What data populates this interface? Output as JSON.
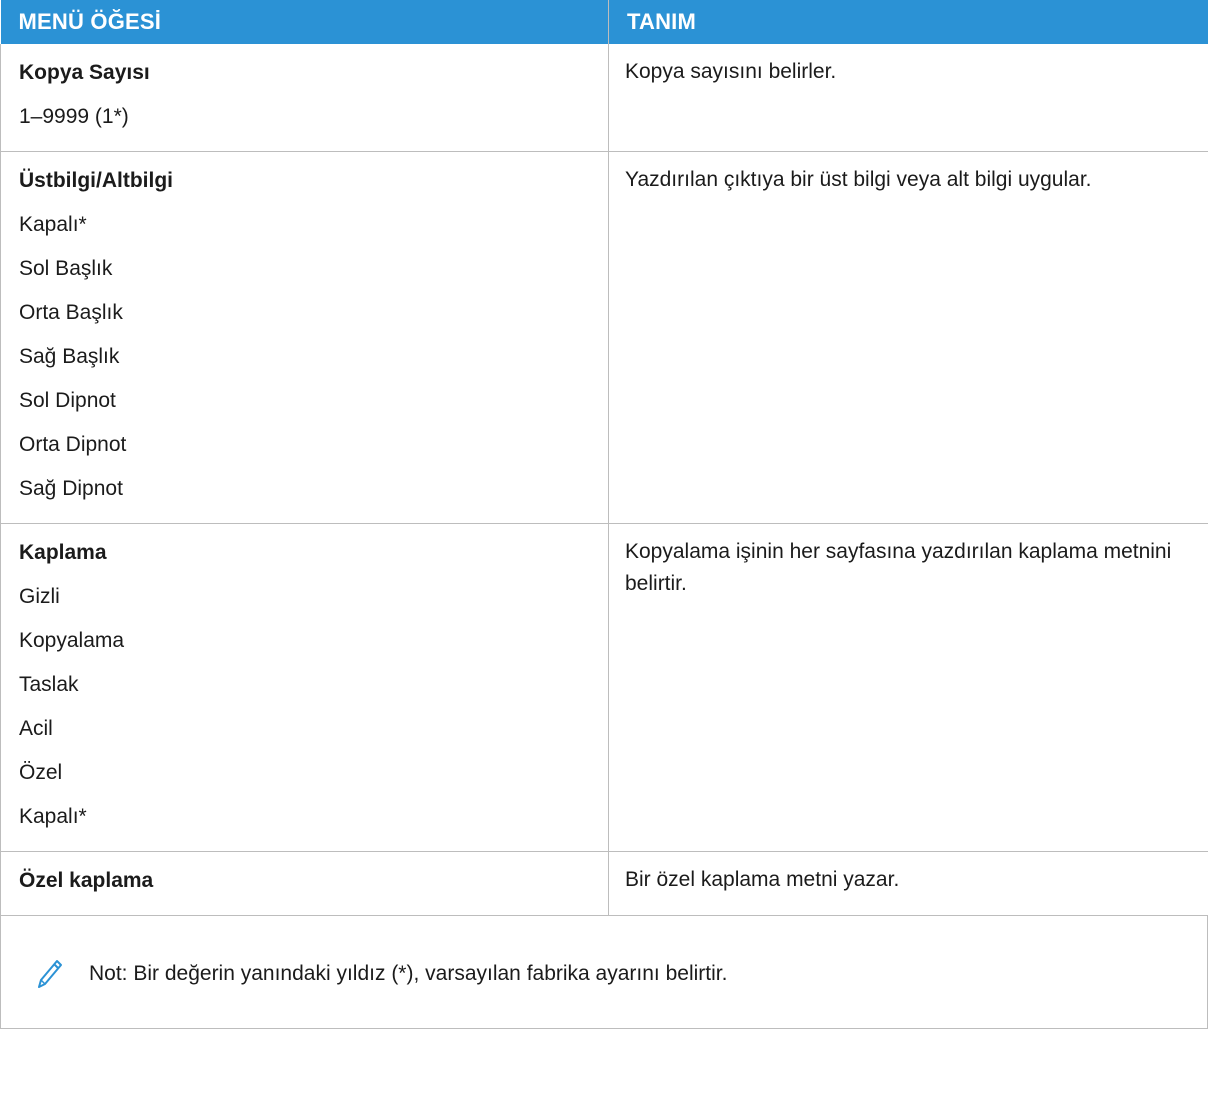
{
  "table": {
    "headers": [
      "MENÜ ÖĞESİ",
      "TANIM"
    ],
    "rows": [
      {
        "name": "Kopya Sayısı",
        "options": [
          "1–9999 (1*)"
        ],
        "description": "Kopya sayısını belirler."
      },
      {
        "name": "Üstbilgi/Altbilgi",
        "options": [
          "Kapalı*",
          "Sol Başlık",
          "Orta Başlık",
          "Sağ Başlık",
          "Sol Dipnot",
          "Orta Dipnot",
          "Sağ Dipnot"
        ],
        "description": "Yazdırılan çıktıya bir üst bilgi veya alt bilgi uygular."
      },
      {
        "name": "Kaplama",
        "options": [
          "Gizli",
          "Kopyalama",
          "Taslak",
          "Acil",
          "Özel",
          "Kapalı*"
        ],
        "description": "Kopyalama işinin her sayfasına yazdırılan kaplama metnini belirtir."
      },
      {
        "name": "Özel kaplama",
        "options": [],
        "description": "Bir özel kaplama metni yazar."
      }
    ]
  },
  "note": {
    "icon": "pencil-icon",
    "text": "Not: Bir değerin yanındaki yıldız (*), varsayılan fabrika ayarını belirtir."
  },
  "colors": {
    "header_background": "#2b92d5",
    "header_text": "#ffffff",
    "border": "#bdbdbd",
    "icon": "#2b92d5"
  }
}
